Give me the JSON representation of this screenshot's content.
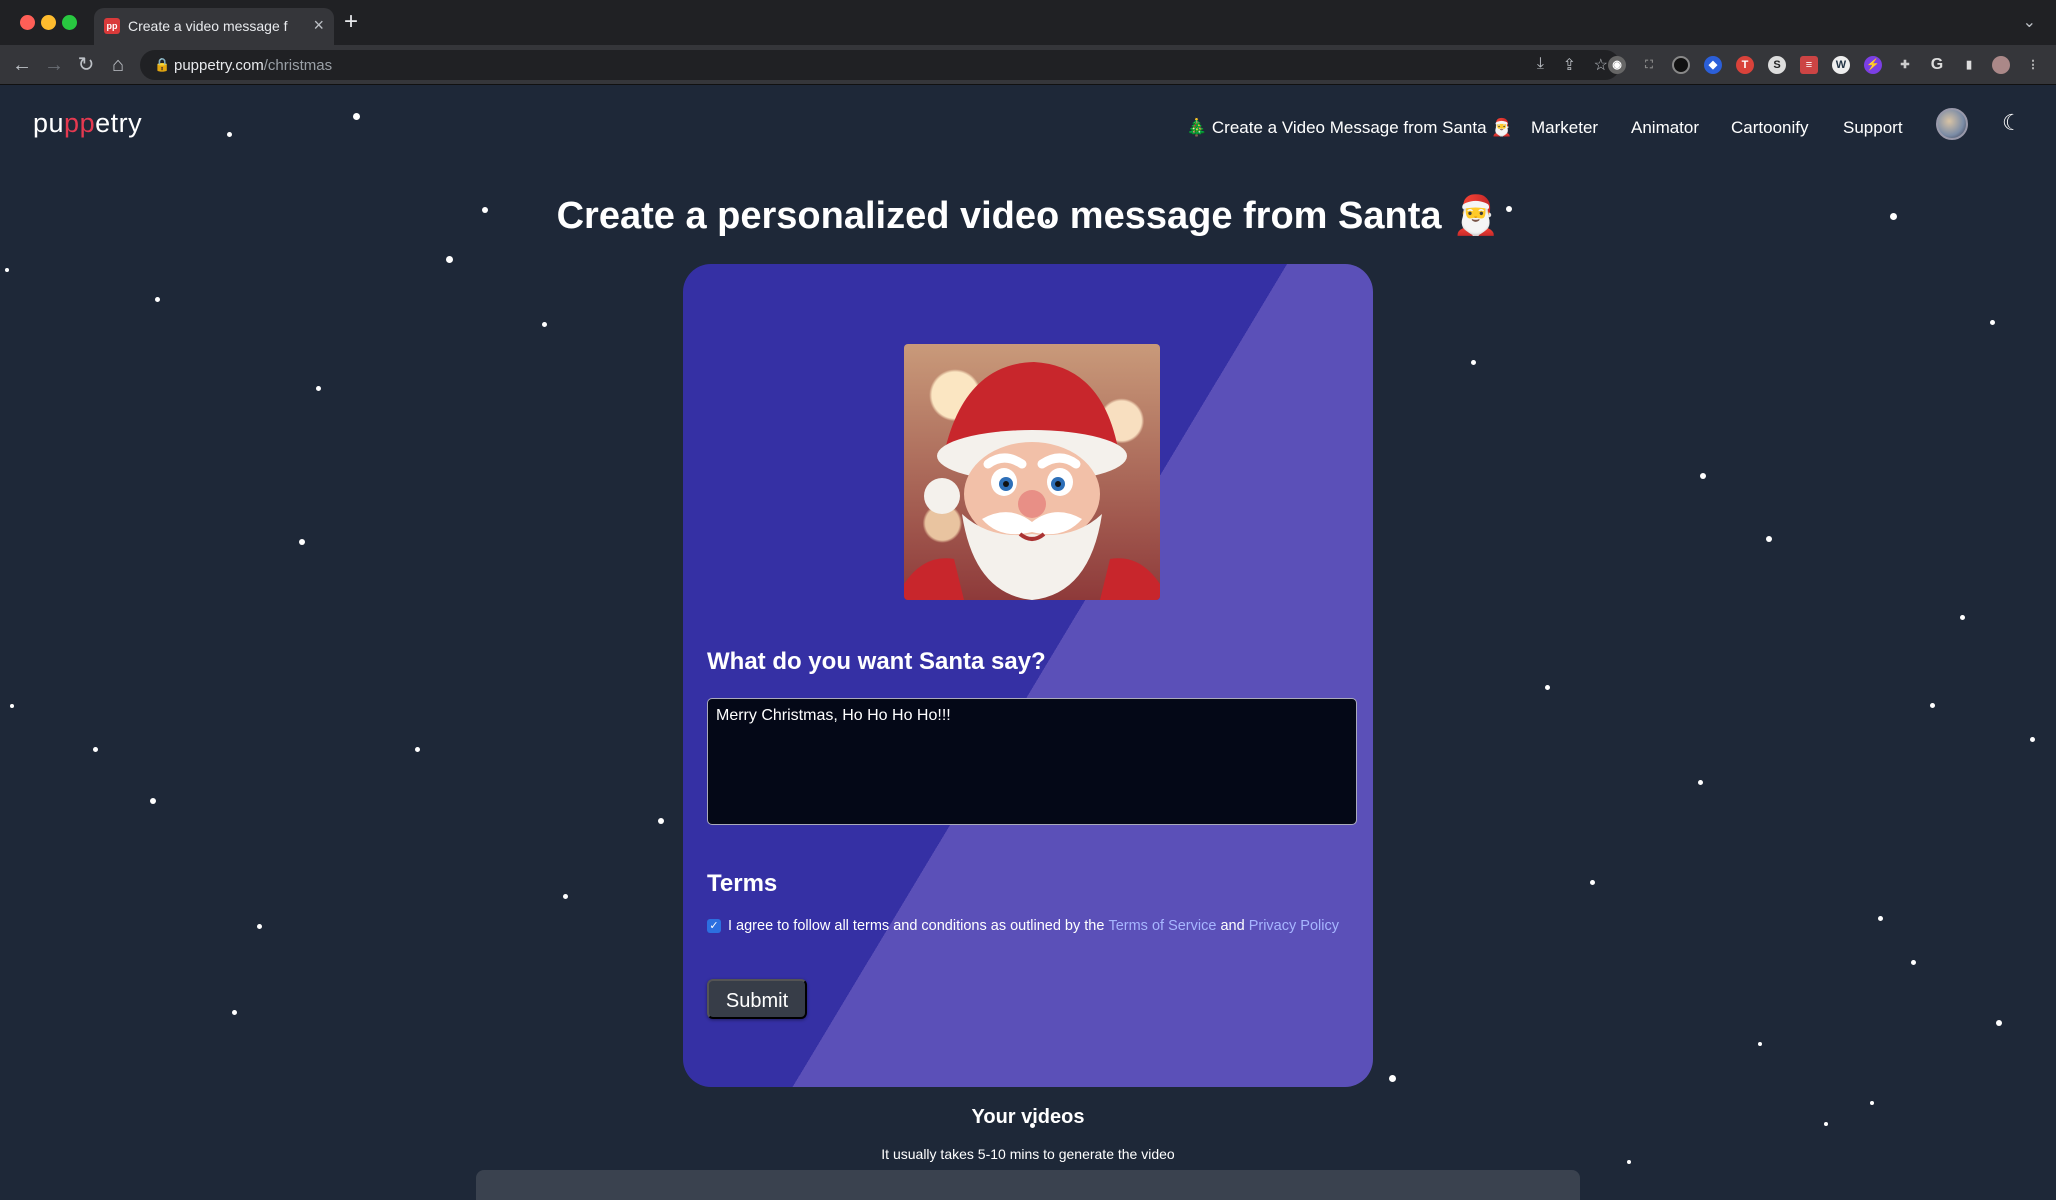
{
  "browser": {
    "tab_title": "Create a video message from",
    "tab_favicon": "pp",
    "url_host": "puppetry.com",
    "url_path": "/christmas"
  },
  "site": {
    "logo_prefix": "pu",
    "logo_highlight": "pp",
    "logo_suffix": "etry",
    "nav": {
      "santa": "🎄 Create a Video Message from Santa 🎅",
      "marketer": "Marketer",
      "animator": "Animator",
      "cartoonify": "Cartoonify",
      "support": "Support"
    }
  },
  "main": {
    "headline": "Create a personalized video message from Santa 🎅",
    "question": "What do you want Santa say?",
    "message": "Merry Christmas, Ho Ho Ho Ho!!!",
    "terms_heading": "Terms",
    "terms_text": "I agree to follow all terms and conditions as outlined by the",
    "terms_link": "Terms of Service",
    "terms_and": "and",
    "privacy_link": "Privacy Policy",
    "terms_checked": true,
    "submit_label": "Submit",
    "videos_heading": "Your videos",
    "videos_note": "It usually takes 5-10 mins to generate the video"
  },
  "colors": {
    "page_bg": "#1e2838",
    "card_dark": "#3530a4",
    "card_light": "#5b50b8",
    "brand_red": "#e53950",
    "link": "#a7b6ff"
  }
}
